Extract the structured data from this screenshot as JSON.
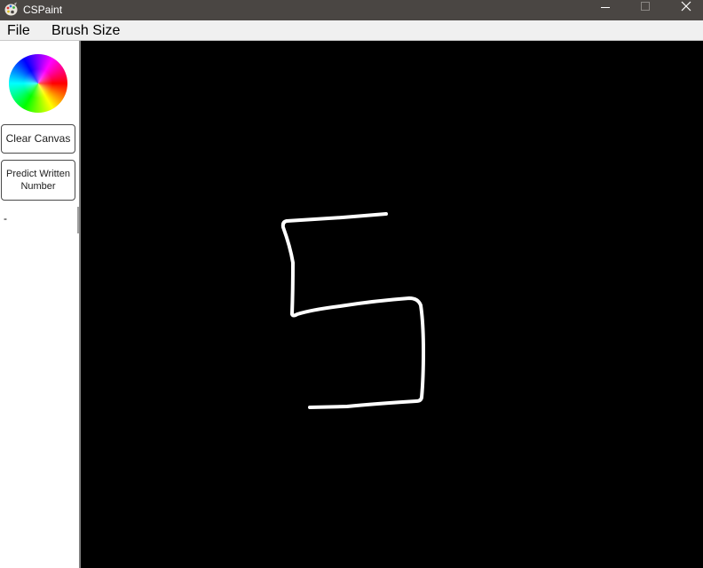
{
  "window": {
    "title": "CSPaint",
    "app_icon": "paint-palette-icon",
    "controls": [
      "minimize-icon",
      "maximize-icon",
      "close-icon"
    ]
  },
  "menu": {
    "items": [
      "File",
      "Brush Size"
    ]
  },
  "sidebar": {
    "color_picker": "color-wheel-icon",
    "clear_button_label": "Clear Canvas",
    "predict_button_label": "Predict Written Number",
    "prediction_result": "-"
  },
  "canvas": {
    "background_color": "#000000",
    "stroke_color": "#ffffff",
    "drawn_content": "5"
  }
}
